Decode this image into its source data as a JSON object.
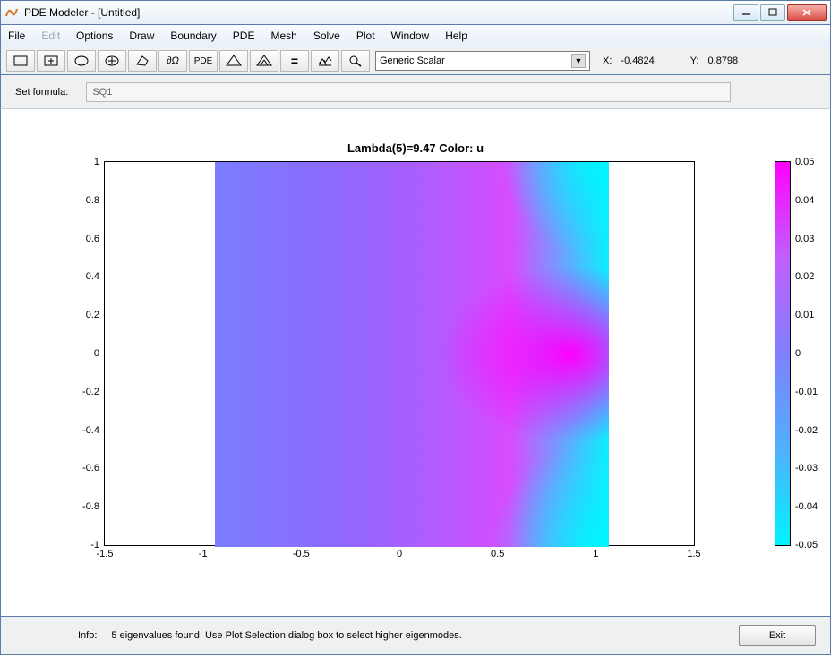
{
  "window": {
    "title": "PDE Modeler - [Untitled]"
  },
  "menu": {
    "file": "File",
    "edit": "Edit",
    "options": "Options",
    "draw": "Draw",
    "boundary": "Boundary",
    "pde": "PDE",
    "mesh": "Mesh",
    "solve": "Solve",
    "plot": "Plot",
    "window": "Window",
    "help": "Help"
  },
  "toolbar": {
    "icons": {
      "rect": "rectangle-icon",
      "rect_center": "rectangle-center-icon",
      "ellipse": "ellipse-icon",
      "ellipse_center": "ellipse-center-icon",
      "polygon": "polygon-icon",
      "boundary": "∂Ω",
      "pde": "PDE",
      "mesh": "mesh-icon",
      "refine": "refine-icon",
      "solve": "=",
      "plot3d": "plot3d-icon",
      "zoom": "zoom-icon"
    },
    "dropdown_value": "Generic Scalar",
    "coord_x_label": "X:",
    "coord_x_value": "-0.4824",
    "coord_y_label": "Y:",
    "coord_y_value": "0.8798"
  },
  "formula": {
    "label": "Set formula:",
    "value": "SQ1"
  },
  "chart_data": {
    "type": "heatmap",
    "title": "Lambda(5)=9.47   Color: u",
    "xlabel": "",
    "ylabel": "",
    "xlim": [
      -1.5,
      1.5
    ],
    "ylim": [
      -1,
      1
    ],
    "xticks": [
      -1.5,
      -1,
      -0.5,
      0,
      0.5,
      1,
      1.5
    ],
    "yticks": [
      -1,
      -0.8,
      -0.6,
      -0.4,
      -0.2,
      0,
      0.2,
      0.4,
      0.6,
      0.8,
      1
    ],
    "data_extent": {
      "xmin": -1,
      "xmax": 1,
      "ymin": -1,
      "ymax": 1
    },
    "colorbar": {
      "min": -0.05,
      "max": 0.05,
      "ticks": [
        -0.05,
        -0.04,
        -0.03,
        -0.02,
        -0.01,
        0,
        0.01,
        0.02,
        0.03,
        0.04,
        0.05
      ],
      "colormap": "cool"
    },
    "description": "Eigenmode solution u on unit square; magnitude peaks near right edge center (magenta ≈ +0.05) and minima near right corners (cyan ≈ -0.05); left side near 0."
  },
  "info": {
    "label": "Info:",
    "message": "5 eigenvalues found. Use Plot Selection dialog box to select higher eigenmodes.",
    "exit": "Exit"
  }
}
